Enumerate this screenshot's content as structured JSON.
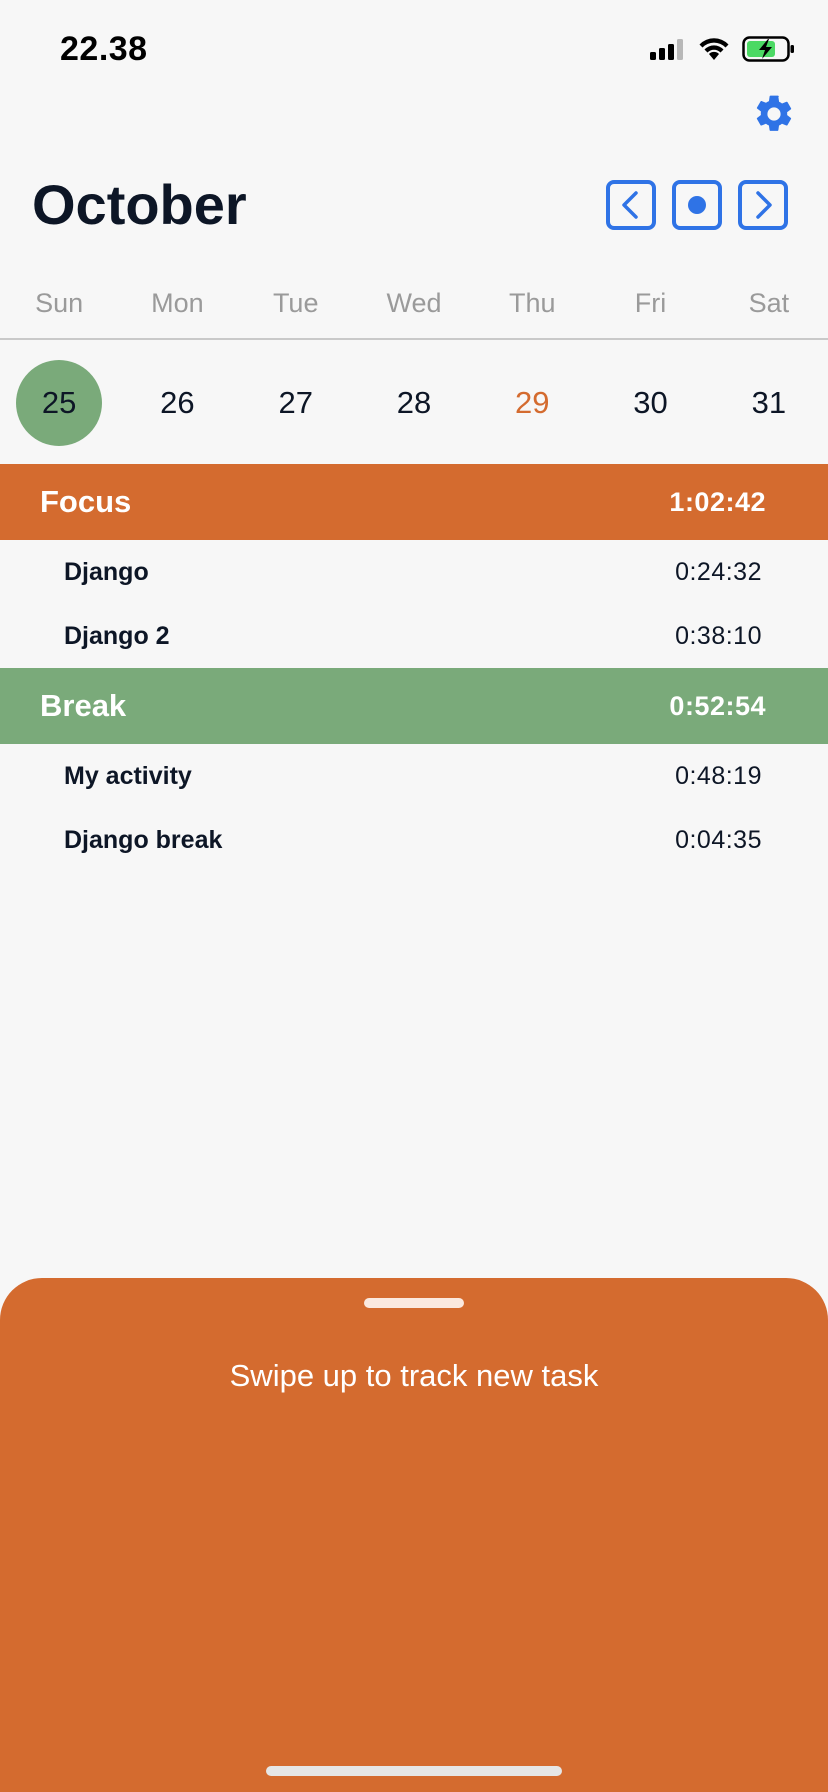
{
  "status_bar": {
    "time": "22.38",
    "icons": [
      "signal-icon",
      "wifi-icon",
      "battery-charging-icon"
    ]
  },
  "header": {
    "settings_icon": "gear-icon",
    "month": "October",
    "nav": {
      "prev_icon": "chevron-left-icon",
      "today_icon": "dot-icon",
      "next_icon": "chevron-right-icon"
    }
  },
  "week": {
    "weekdays": [
      "Sun",
      "Mon",
      "Tue",
      "Wed",
      "Thu",
      "Fri",
      "Sat"
    ],
    "days": [
      "25",
      "26",
      "27",
      "28",
      "29",
      "30",
      "31"
    ],
    "selected_day": "25",
    "today": "29"
  },
  "groups": [
    {
      "name": "Focus",
      "total": "1:02:42",
      "color": "#d46b2f",
      "items": [
        {
          "name": "Django",
          "time": "0:24:32"
        },
        {
          "name": "Django 2",
          "time": "0:38:10"
        }
      ]
    },
    {
      "name": "Break",
      "total": "0:52:54",
      "color": "#7aaa7a",
      "items": [
        {
          "name": "My activity",
          "time": "0:48:19"
        },
        {
          "name": "Django break",
          "time": "0:04:35"
        }
      ]
    }
  ],
  "sheet": {
    "hint": "Swipe up to track new task",
    "color": "#d46b2f"
  },
  "colors": {
    "accent": "#2f73e6",
    "today": "#d46b2f",
    "selected": "#7aaa7a"
  }
}
